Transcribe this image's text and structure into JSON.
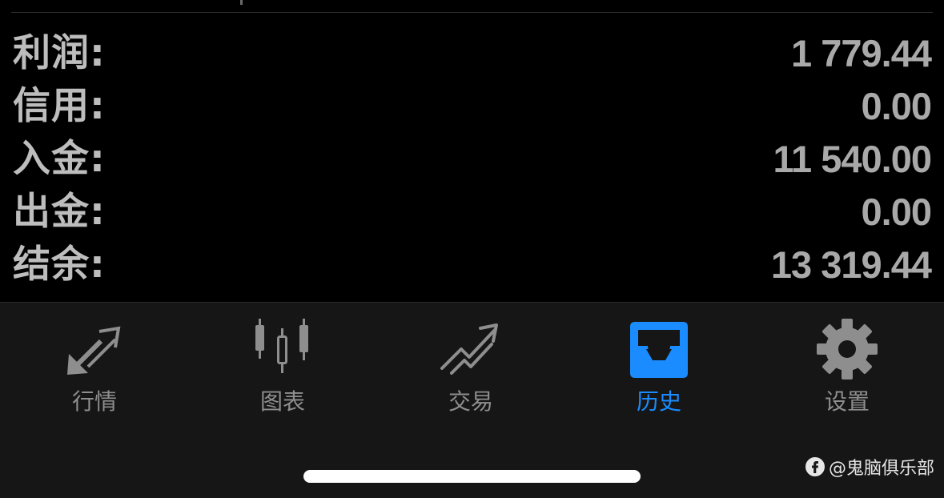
{
  "summary": {
    "rows": [
      {
        "label": "利润:",
        "value": "1 779.44"
      },
      {
        "label": "信用:",
        "value": "0.00"
      },
      {
        "label": "入金:",
        "value": "11 540.00"
      },
      {
        "label": "出金:",
        "value": "0.00"
      },
      {
        "label": "结余:",
        "value": "13 319.44"
      }
    ]
  },
  "tabbar": {
    "tabs": [
      {
        "label": "行情",
        "icon": "quotes-arrows-icon",
        "active": false
      },
      {
        "label": "图表",
        "icon": "candlestick-chart-icon",
        "active": false
      },
      {
        "label": "交易",
        "icon": "trade-trend-icon",
        "active": false
      },
      {
        "label": "历史",
        "icon": "history-inbox-icon",
        "active": true
      },
      {
        "label": "设置",
        "icon": "gear-icon",
        "active": false
      }
    ]
  },
  "watermark": {
    "text": "@鬼脑俱乐部"
  },
  "colors": {
    "background": "#000000",
    "tabbar_background": "#161616",
    "label_text": "#bdbdbd",
    "value_text": "#a9a9a9",
    "tab_inactive": "#8e8e8e",
    "tab_active": "#1a8cff"
  }
}
